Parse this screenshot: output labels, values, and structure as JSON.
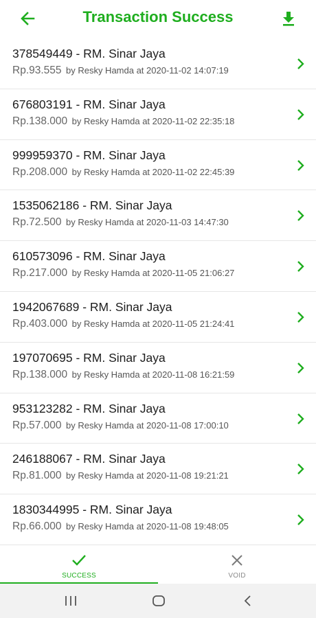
{
  "header": {
    "title": "Transaction Success",
    "back_icon": "arrow-left-icon",
    "download_icon": "download-icon",
    "accent": "#1fae1f"
  },
  "transactions": [
    {
      "title": "378549449 - RM. Sinar Jaya",
      "amount": "Rp.93.555",
      "meta": "by Resky Hamda at 2020-11-02 14:07:19"
    },
    {
      "title": "676803191 - RM. Sinar Jaya",
      "amount": "Rp.138.000",
      "meta": "by Resky Hamda at 2020-11-02 22:35:18"
    },
    {
      "title": "999959370 - RM. Sinar Jaya",
      "amount": "Rp.208.000",
      "meta": "by Resky Hamda at 2020-11-02 22:45:39"
    },
    {
      "title": "1535062186 - RM. Sinar Jaya",
      "amount": "Rp.72.500",
      "meta": "by Resky Hamda at 2020-11-03 14:47:30"
    },
    {
      "title": "610573096 - RM. Sinar Jaya",
      "amount": "Rp.217.000",
      "meta": "by Resky Hamda at 2020-11-05 21:06:27"
    },
    {
      "title": "1942067689 - RM. Sinar Jaya",
      "amount": "Rp.403.000",
      "meta": "by Resky Hamda at 2020-11-05 21:24:41"
    },
    {
      "title": "197070695 - RM. Sinar Jaya",
      "amount": "Rp.138.000",
      "meta": "by Resky Hamda at 2020-11-08 16:21:59"
    },
    {
      "title": "953123282 - RM. Sinar Jaya",
      "amount": "Rp.57.000",
      "meta": "by Resky Hamda at 2020-11-08 17:00:10"
    },
    {
      "title": "246188067 - RM. Sinar Jaya",
      "amount": "Rp.81.000",
      "meta": "by Resky Hamda at 2020-11-08 19:21:21"
    },
    {
      "title": "1830344995 - RM. Sinar Jaya",
      "amount": "Rp.66.000",
      "meta": "by Resky Hamda at 2020-11-08 19:48:05"
    }
  ],
  "tabs": [
    {
      "label": "SUCCESS",
      "icon": "check-icon",
      "active": true
    },
    {
      "label": "VOID",
      "icon": "close-icon",
      "active": false
    }
  ],
  "system_nav": {
    "recents_icon": "recents-icon",
    "home_icon": "home-icon",
    "back_icon": "system-back-icon"
  }
}
